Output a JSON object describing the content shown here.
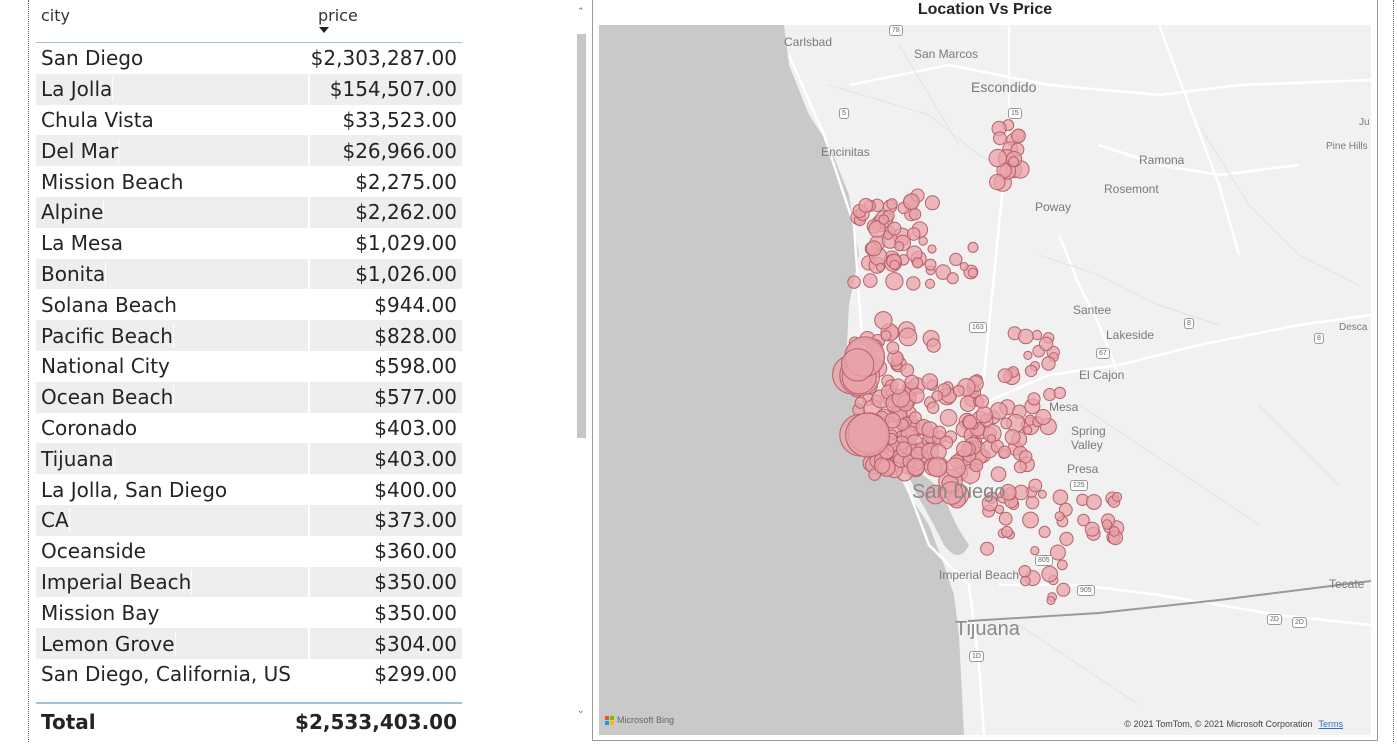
{
  "table": {
    "columns": {
      "city": "city",
      "price": "price"
    },
    "rows": [
      {
        "city": "San Diego",
        "price": "$2,303,287.00"
      },
      {
        "city": "La Jolla",
        "price": "$154,507.00"
      },
      {
        "city": "Chula Vista",
        "price": "$33,523.00"
      },
      {
        "city": "Del Mar",
        "price": "$26,966.00"
      },
      {
        "city": "Mission Beach",
        "price": "$2,275.00"
      },
      {
        "city": "Alpine",
        "price": "$2,262.00"
      },
      {
        "city": "La Mesa",
        "price": "$1,029.00"
      },
      {
        "city": "Bonita",
        "price": "$1,026.00"
      },
      {
        "city": "Solana Beach",
        "price": "$944.00"
      },
      {
        "city": "Pacific Beach",
        "price": "$828.00"
      },
      {
        "city": "National City",
        "price": "$598.00"
      },
      {
        "city": "Ocean Beach",
        "price": "$577.00"
      },
      {
        "city": "Coronado",
        "price": "$403.00"
      },
      {
        "city": "Tijuana",
        "price": "$403.00"
      },
      {
        "city": "La Jolla, San Diego",
        "price": "$400.00"
      },
      {
        "city": "CA",
        "price": "$373.00"
      },
      {
        "city": "Oceanside",
        "price": "$360.00"
      },
      {
        "city": "Imperial Beach",
        "price": "$350.00"
      },
      {
        "city": "Mission Bay",
        "price": "$350.00"
      },
      {
        "city": "Lemon Grove",
        "price": "$304.00"
      },
      {
        "city": "San Diego, California, US",
        "price": "$299.00"
      }
    ],
    "total_label": "Total",
    "total_value": "$2,533,403.00",
    "sort_indicator": "sort-descending-icon",
    "scroll_position": 0.0
  },
  "map": {
    "title": "Location Vs Price",
    "place_labels": [
      "Carlsbad",
      "San Marcos",
      "Escondido",
      "Encinitas",
      "Ramona",
      "Rosemont",
      "Poway",
      "Santee",
      "Lakeside",
      "El Cajon",
      "Mesa",
      "Spring Valley",
      "Presa",
      "San Diego",
      "Imperial Beach",
      "Tijuana",
      "Tecate",
      "Pine Hills",
      "Desca",
      "Ju"
    ],
    "road_shields": [
      "78",
      "5",
      "15",
      "163",
      "67",
      "8",
      "8",
      "125",
      "805",
      "905",
      "2D",
      "2D",
      "1D"
    ],
    "bing_label": "Microsoft Bing",
    "copyright": "© 2021 TomTom, © 2021 Microsoft Corporation",
    "terms": "Terms",
    "colors": {
      "bubble_fill": "#e8a3a8",
      "bubble_stroke": "#b8606a",
      "ocean": "#c8c8c8",
      "land": "#f1f1f1",
      "roads": "#ffffff"
    }
  }
}
